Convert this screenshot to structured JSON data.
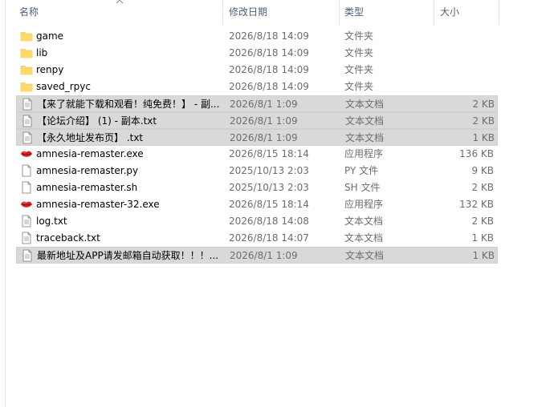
{
  "columns": {
    "name": "名称",
    "date": "修改日期",
    "type": "类型",
    "size": "大小"
  },
  "files": [
    {
      "name": "game",
      "date": "2026/8/18 14:09",
      "type": "文件夹",
      "size": "",
      "icon": "folder-icon",
      "selected": false
    },
    {
      "name": "lib",
      "date": "2026/8/18 14:09",
      "type": "文件夹",
      "size": "",
      "icon": "folder-icon",
      "selected": false
    },
    {
      "name": "renpy",
      "date": "2026/8/18 14:09",
      "type": "文件夹",
      "size": "",
      "icon": "folder-icon",
      "selected": false
    },
    {
      "name": "saved_rpyc",
      "date": "2026/8/18 14:09",
      "type": "文件夹",
      "size": "",
      "icon": "folder-icon",
      "selected": false
    },
    {
      "name": "【来了就能下载和观看！纯免费！】 - 副...",
      "date": "2026/8/1 1:09",
      "type": "文本文档",
      "size": "2 KB",
      "icon": "text-file-icon",
      "selected": true
    },
    {
      "name": "【论坛介绍】 (1) - 副本.txt",
      "date": "2026/8/1 1:09",
      "type": "文本文档",
      "size": "2 KB",
      "icon": "text-file-icon",
      "selected": true
    },
    {
      "name": "【永久地址发布页】 .txt",
      "date": "2026/8/1 1:09",
      "type": "文本文档",
      "size": "1 KB",
      "icon": "text-file-icon",
      "selected": true
    },
    {
      "name": "amnesia-remaster.exe",
      "date": "2026/8/15 18:14",
      "type": "应用程序",
      "size": "136 KB",
      "icon": "lips-app-icon",
      "selected": false
    },
    {
      "name": "amnesia-remaster.py",
      "date": "2025/10/13 2:03",
      "type": "PY 文件",
      "size": "9 KB",
      "icon": "file-icon",
      "selected": false
    },
    {
      "name": "amnesia-remaster.sh",
      "date": "2025/10/13 2:03",
      "type": "SH 文件",
      "size": "2 KB",
      "icon": "file-icon",
      "selected": false
    },
    {
      "name": "amnesia-remaster-32.exe",
      "date": "2026/8/15 18:14",
      "type": "应用程序",
      "size": "132 KB",
      "icon": "lips-app-icon",
      "selected": false
    },
    {
      "name": "log.txt",
      "date": "2026/8/18 14:08",
      "type": "文本文档",
      "size": "2 KB",
      "icon": "text-file-icon",
      "selected": false
    },
    {
      "name": "traceback.txt",
      "date": "2026/8/18 14:07",
      "type": "文本文档",
      "size": "1 KB",
      "icon": "text-file-icon",
      "selected": false
    },
    {
      "name": "最新地址及APP请发邮箱自动获取！！！...",
      "date": "2026/8/1 1:09",
      "type": "文本文档",
      "size": "1 KB",
      "icon": "text-file-icon",
      "selected": true,
      "focused": true
    }
  ],
  "colors": {
    "folder": "#f8d775",
    "selection": "#d9d9d9",
    "header_text": "#4c607a",
    "secondary_text": "#6d6d6d"
  }
}
